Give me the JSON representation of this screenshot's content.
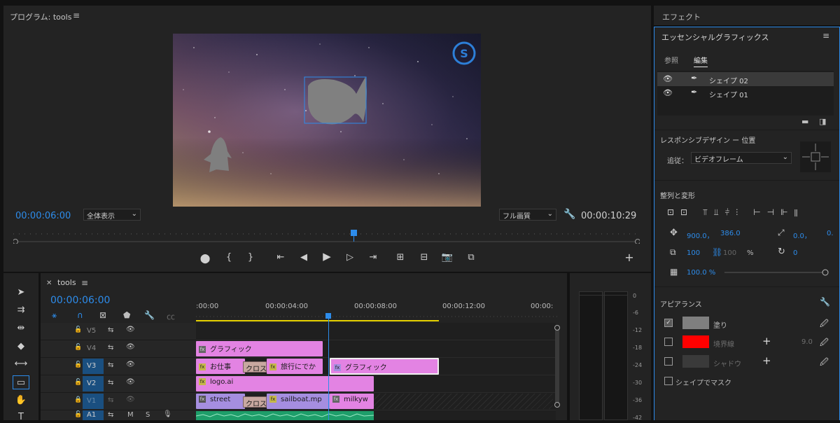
{
  "program_monitor": {
    "title": "プログラム: tools",
    "timecode_current": "00:00:06:00",
    "zoom_value": "全体表示",
    "quality_value": "フル画質",
    "timecode_duration": "00:00:10:29"
  },
  "effects_tab": "エフェクト",
  "essential_graphics": {
    "title": "エッセンシャルグラフィックス",
    "tabs": [
      "参照",
      "編集"
    ],
    "layers": [
      {
        "name": "シェイプ 02",
        "selected": true
      },
      {
        "name": "シェイプ 01",
        "selected": false
      }
    ],
    "responsive_title": "レスポンシブデザイン ー 位置",
    "follow_label": "追従：",
    "follow_value": "ビデオフレーム",
    "align_title": "整列と変形",
    "pos_x": "900.0，",
    "pos_y": "386.0",
    "anchor_x": "0.0，",
    "anchor_y": "0.",
    "scale": "100",
    "scale_linked": "100",
    "percent": "%",
    "rotation": "0",
    "opacity": "100.0 %",
    "opacity_value": 100,
    "appearance_title": "アピアランス",
    "fill_label": "塗り",
    "stroke_label": "境界線",
    "stroke_width": "9.0",
    "shadow_label": "シャドウ",
    "mask_label": "シェイプでマスク",
    "fill_color": "#7f7f7f",
    "stroke_color": "#ff0000",
    "shadow_color": "#3a3a3a"
  },
  "timeline": {
    "seq_name": "tools",
    "timecode": "00:00:06:00",
    "ruler": [
      ":00:00",
      "00:00:04:00",
      "00:00:08:00",
      "00:00:12:00",
      "00:00:"
    ],
    "tracks": [
      {
        "name": "V5"
      },
      {
        "name": "V4"
      },
      {
        "name": "V3"
      },
      {
        "name": "V2"
      },
      {
        "name": "V1"
      },
      {
        "name": "A1"
      }
    ],
    "track_s_label": "S",
    "clips": {
      "v4_graphic": "グラフィック",
      "v3_work": "お仕事",
      "v3_cross": "クロス",
      "v3_travel": "旅行にでか",
      "v3_graphic2": "グラフィック",
      "v2_logo": "logo.ai",
      "v1_street": "street",
      "v1_cross": "クロス",
      "v1_sailboat": "sailboat.mp",
      "v1_milky": "milkyw"
    }
  },
  "meter_labels": [
    "0",
    "-6",
    "-12",
    "-18",
    "-24",
    "-30",
    "-36",
    "-42"
  ],
  "colors": {
    "accent": "#2d8ceb",
    "clip_pink": "#e383e3",
    "clip_purple": "#a58ee0"
  }
}
